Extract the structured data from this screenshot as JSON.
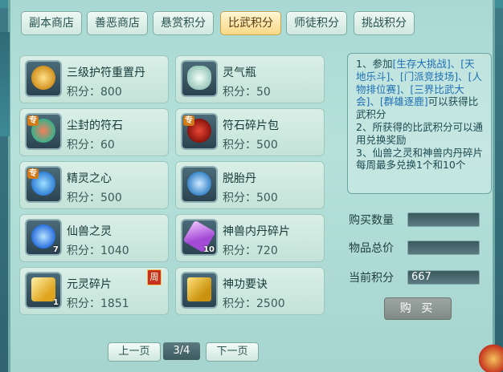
{
  "tabs": [
    {
      "label": "副本商店",
      "active": false
    },
    {
      "label": "善恶商店",
      "active": false
    },
    {
      "label": "悬赏积分",
      "active": false
    },
    {
      "label": "比武积分",
      "active": true
    },
    {
      "label": "师徒积分",
      "active": false
    },
    {
      "label": "挑战积分",
      "active": false
    }
  ],
  "items": [
    {
      "name": "三级护符重置丹",
      "price": "积分：800",
      "icon": "gold-amulet-icon",
      "qty": "",
      "tag": "",
      "color": "#e3a62a"
    },
    {
      "name": "灵气瓶",
      "price": "积分：50",
      "icon": "spirit-bottle-icon",
      "qty": "",
      "tag": "",
      "color": "#cfe7df"
    },
    {
      "name": "尘封的符石",
      "price": "积分：60",
      "icon": "rune-stone-icon",
      "qty": "",
      "tag": "专",
      "color": "#3bb08a"
    },
    {
      "name": "符石碎片包",
      "price": "积分：500",
      "icon": "rune-fragment-bag-icon",
      "qty": "",
      "tag": "专",
      "color": "#b8261c"
    },
    {
      "name": "精灵之心",
      "price": "积分：500",
      "icon": "spirit-heart-icon",
      "qty": "",
      "tag": "专",
      "color": "#2f7fd6"
    },
    {
      "name": "脱胎丹",
      "price": "积分：500",
      "icon": "rebirth-pill-icon",
      "qty": "",
      "tag": "",
      "color": "#3a86c9"
    },
    {
      "name": "仙兽之灵",
      "price": "积分：1040",
      "icon": "beast-spirit-orb-icon",
      "qty": "7",
      "tag": "",
      "color": "#2a6fe0"
    },
    {
      "name": "神兽内丹碎片",
      "price": "积分：720",
      "icon": "purple-crystal-icon",
      "qty": "10",
      "tag": "",
      "color": "#a34ad6"
    },
    {
      "name": "元灵碎片",
      "price": "积分：1851",
      "icon": "gold-fragment-icon",
      "qty": "1",
      "tag": "",
      "color": "#f0c23a",
      "weekly": "周"
    },
    {
      "name": "神功要诀",
      "price": "积分：2500",
      "icon": "golden-book-icon",
      "qty": "",
      "tag": "",
      "color": "#e9b923"
    }
  ],
  "info": {
    "line1_prefix": "1、参加",
    "line1_links": "[生存大挑战]、[天地乐斗]、[门派竞技场]、[人物排位赛]、[三界比武大会]、[群雄逐鹿]",
    "line1_suffix": "可以获得比武积分",
    "line2": "2、所获得的比武积分可以通用兑换奖励",
    "line3": "3、仙兽之灵和神兽内丹碎片每周最多兑换1个和10个"
  },
  "purchase": {
    "qty_label": "购买数量",
    "qty_value": "",
    "total_label": "物品总价",
    "total_value": "",
    "current_label": "当前积分",
    "current_value": "667",
    "buy_label": "购 买"
  },
  "pager": {
    "prev": "上一页",
    "indicator": "3/4",
    "next": "下一页"
  }
}
